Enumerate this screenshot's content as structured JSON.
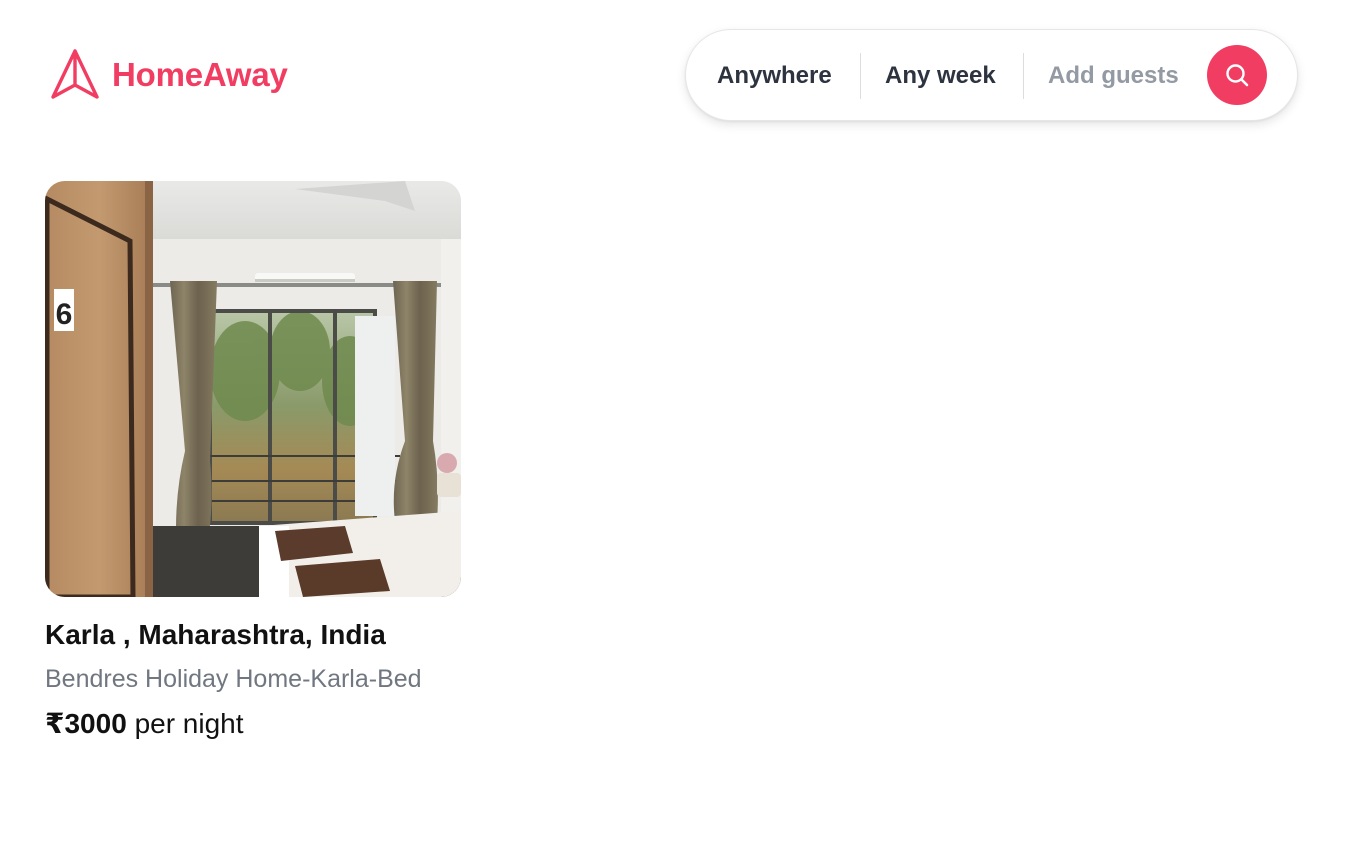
{
  "brand": {
    "name": "HomeAway",
    "icon": "paper-plane-icon",
    "accent_color": "#f23d63"
  },
  "search": {
    "location_label": "Anywhere",
    "week_label": "Any week",
    "guests_placeholder": "Add guests",
    "button_icon": "search-icon"
  },
  "listings": [
    {
      "location": "Karla , Maharashtra, India",
      "name": "Bendres Holiday Home-Karla-Bed",
      "price": "₹3000",
      "price_unit": "per night",
      "photo_door_number": "6"
    }
  ]
}
